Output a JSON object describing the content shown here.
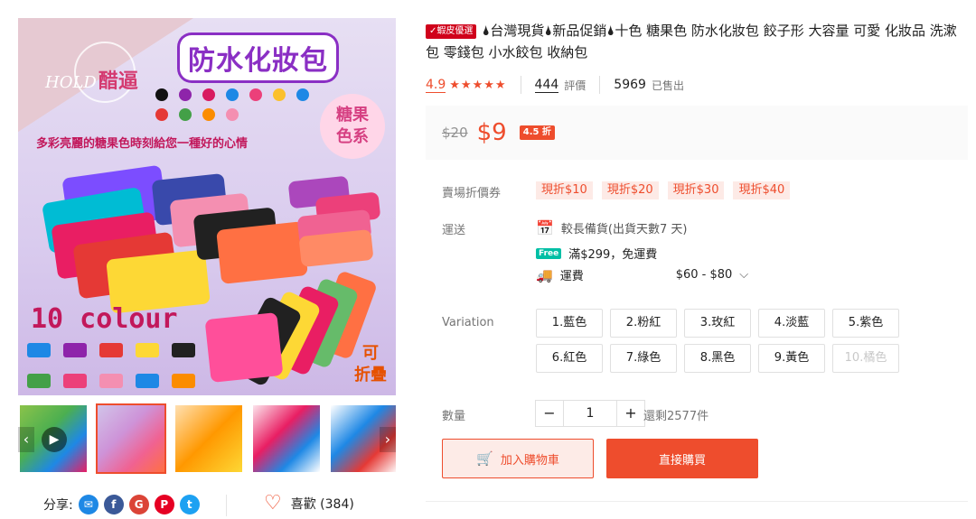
{
  "image": {
    "brand_text": "HOLD",
    "brand_cn": "醋逼",
    "headline": "防水化妝包",
    "tagline": "多彩亮麗的糖果色時刻給您一種好的心情",
    "corner_tag": "糖果\n色系",
    "colour_text": "10 colour",
    "foldable_text": "可\n折疊",
    "dot_colors": [
      "#111111",
      "#8e24aa",
      "#d81b60",
      "#1e88e5",
      "#ec407a",
      "#fbc02d",
      "#1e88e5",
      "#e53935",
      "#43a047",
      "#fb8c00",
      "#f48fb1"
    ]
  },
  "thumbnails": [
    {
      "name": "thumb-video",
      "active": false,
      "play_icon": "play-icon"
    },
    {
      "name": "thumb-2",
      "active": true
    },
    {
      "name": "thumb-3",
      "active": false
    },
    {
      "name": "thumb-4",
      "active": false
    },
    {
      "name": "thumb-5",
      "active": false
    }
  ],
  "share": {
    "label": "分享:",
    "icons": [
      "messenger-icon",
      "facebook-icon",
      "google-plus-icon",
      "pinterest-icon",
      "twitter-icon"
    ]
  },
  "like": {
    "label": "喜歡 (384)"
  },
  "product": {
    "preferred_badge": "✓蝦皮優選",
    "title": "🌢台灣現貨🌢新品促銷🌢十色 糖果色 防水化妝包 餃子形 大容量 可愛 化妝品 洗漱包 零錢包 小水餃包 收納包",
    "rating": "4.9",
    "stars": "★★★★★",
    "reviews_count": "444",
    "reviews_label": "評價",
    "sold_count": "5969",
    "sold_label": "已售出",
    "old_price": "$20",
    "new_price": "$9",
    "discount": "4.5 折"
  },
  "vouchers": {
    "label": "賣場折價券",
    "items": [
      "現折$10",
      "現折$20",
      "現折$30",
      "現折$40"
    ]
  },
  "shipping": {
    "label": "運送",
    "long_prep": "較長備貨(出貨天數7 天)",
    "free_tag": "Free",
    "free_text": "滿$299，免運費",
    "fee_label": "運費",
    "fee_range": "$60 - $80"
  },
  "variation": {
    "label": "Variation",
    "options": [
      "1.藍色",
      "2.粉紅",
      "3.玫紅",
      "4.淡藍",
      "5.紫色",
      "6.紅色",
      "7.綠色",
      "8.黑色",
      "9.黃色",
      "10.橘色"
    ],
    "disabled": [
      false,
      false,
      false,
      false,
      false,
      false,
      false,
      false,
      false,
      true
    ]
  },
  "quantity": {
    "label": "數量",
    "value": "1",
    "minus": "−",
    "plus": "+",
    "stock": "還剩2577件"
  },
  "actions": {
    "add_to_cart": "加入購物車",
    "buy_now": "直接購買"
  },
  "colors": {
    "accent": "#ee4d2d"
  }
}
